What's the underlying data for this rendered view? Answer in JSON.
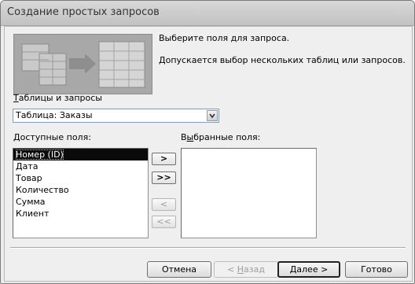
{
  "window": {
    "title": "Создание простых запросов"
  },
  "instructions": {
    "line1": "Выберите поля для запроса.",
    "line2": "Допускается выбор нескольких таблиц или запросов."
  },
  "tables": {
    "label_mnemonic": "Т",
    "label_rest": "аблицы и запросы",
    "selected": "Таблица: Заказы"
  },
  "available": {
    "label_mnemonic": "Д",
    "label_rest": "оступные поля:",
    "items": [
      "Номер (ID)",
      "Дата",
      "Товар",
      "Количество",
      "Сумма",
      "Клиент"
    ]
  },
  "selected_fields": {
    "label_pre": "В",
    "label_mnemonic": "ы",
    "label_rest": "бранные поля:",
    "items": []
  },
  "move_buttons": {
    "add": ">",
    "add_all": ">>",
    "remove": "<",
    "remove_all": "<<"
  },
  "buttons": {
    "cancel": "Отмена",
    "back_pre": "< ",
    "back_mnemonic": "Н",
    "back_rest": "азад",
    "next_mnemonic": "Д",
    "next_rest": "алее >",
    "finish": "Готово"
  }
}
